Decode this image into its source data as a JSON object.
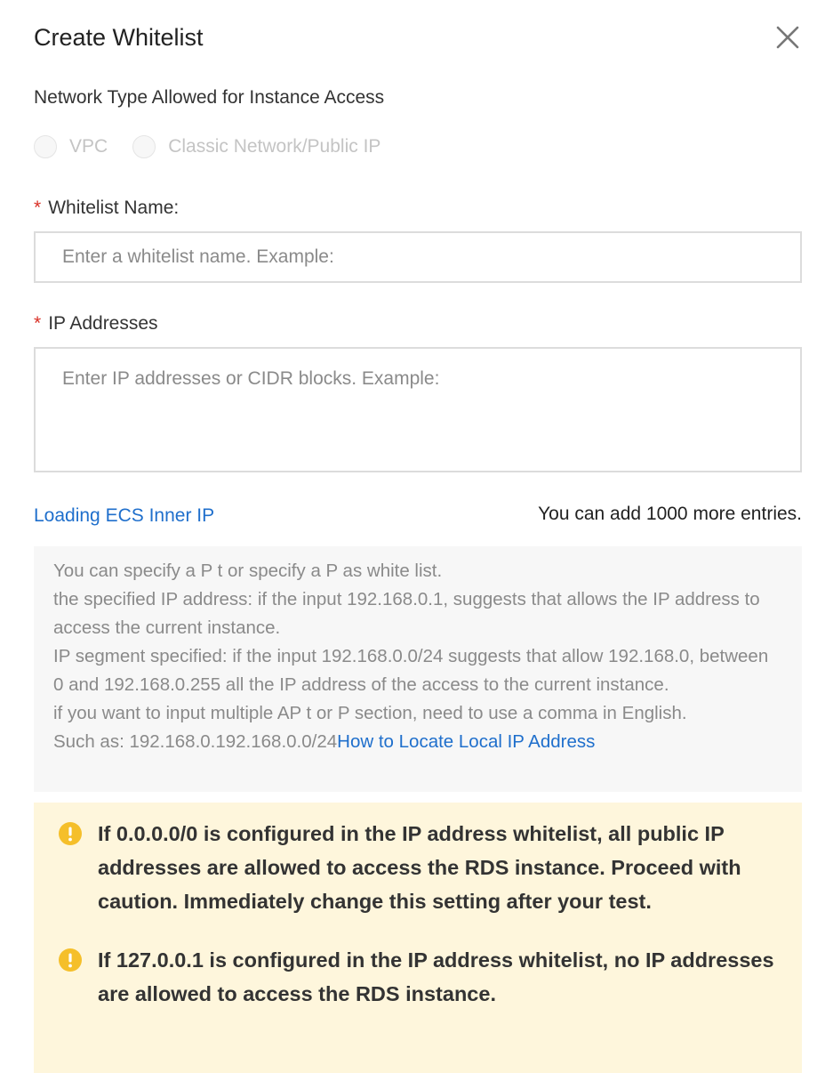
{
  "dialog": {
    "title": "Create Whitelist"
  },
  "network_type": {
    "label": "Network Type Allowed for Instance Access",
    "options": [
      {
        "label": "VPC"
      },
      {
        "label": "Classic Network/Public IP"
      }
    ]
  },
  "whitelist_name": {
    "required_mark": "*",
    "label": "Whitelist Name:",
    "value": "",
    "placeholder": "Enter a whitelist name. Example:"
  },
  "ip_addresses": {
    "required_mark": "*",
    "label": "IP Addresses",
    "value": "",
    "placeholder": "Enter IP addresses or CIDR blocks. Example:"
  },
  "links": {
    "loading_ecs": "Loading ECS Inner IP",
    "locate_ip": "How to Locate Local IP Address"
  },
  "entries_remaining": "You can add 1000 more entries.",
  "help": {
    "line1": "You can specify a P t or specify a P as white list.",
    "line2": "the specified IP address: if the input 192.168.0.1, suggests that allows the IP address to access the current instance.",
    "line3": "IP segment specified: if the input 192.168.0.0/24 suggests that allow 192.168.0, between 0 and 192.168.0.255 all the IP address of the access to the current instance.",
    "line4": "if you want to input multiple AP t or P section, need to use a comma in English.",
    "line5": "Such as: 192.168.0.192.168.0.0/24"
  },
  "warnings": [
    {
      "text": "If 0.0.0.0/0 is configured in the IP address whitelist, all public IP addresses are allowed to access the RDS instance. Proceed with caution. Immediately change this setting after your test."
    },
    {
      "text": "If 127.0.0.1 is configured in the IP address whitelist, no IP addresses are allowed to access the RDS instance."
    }
  ],
  "colors": {
    "required": "#d93026",
    "link": "#1f6fcc",
    "warning_bg": "#fef6dc",
    "warning_icon": "#f5bf2a",
    "help_bg": "#f7f7f7"
  },
  "icons": {
    "close": "close-icon",
    "warning": "exclamation-circle-icon"
  }
}
